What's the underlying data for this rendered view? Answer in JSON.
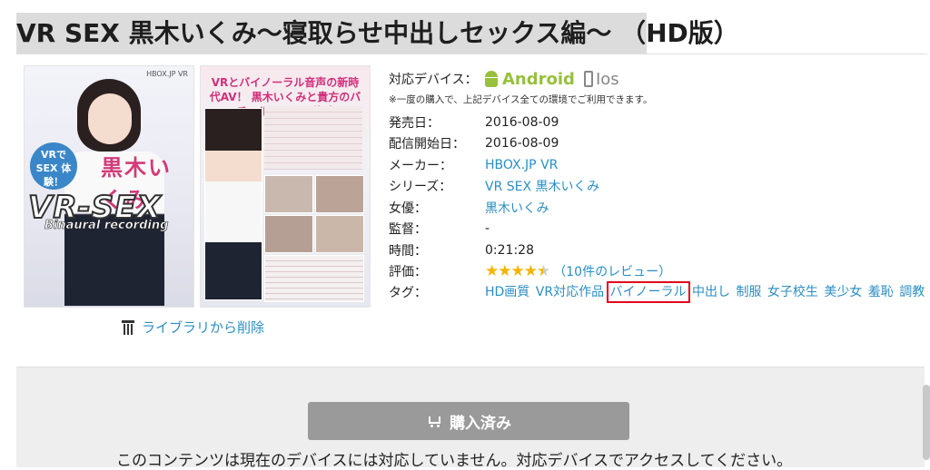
{
  "title": "VR SEX 黒木いくみ〜寝取らせ中出しセックス編〜 （HD版）",
  "cover": {
    "brand": "HBOX.JP VR",
    "badge": "VRで SEX 体験！",
    "name": "黒木いくみ",
    "logo": "VR-SEX",
    "sub": "Binaural recording"
  },
  "back_cover": {
    "headline": "VRとバイノーラル音声の新時代AV！ 黒木いくみと貴方のバーチャルセックス体験！"
  },
  "devices": {
    "label": "対応デバイス：",
    "android": "Android",
    "ios": "Ios",
    "note": "※一度の購入で、上記デバイス全ての環境でご利用できます。"
  },
  "details": {
    "release_label": "発売日：",
    "release": "2016-08-09",
    "stream_label": "配信開始日：",
    "stream": "2016-08-09",
    "maker_label": "メーカー：",
    "maker": "HBOX.JP VR",
    "series_label": "シリーズ：",
    "series": "VR SEX 黒木いくみ",
    "actress_label": "女優：",
    "actress": "黒木いくみ",
    "director_label": "監督：",
    "director": "-",
    "duration_label": "時間：",
    "duration": "0:21:28",
    "rating_label": "評価：",
    "rating": 4.5,
    "rating_max": 5,
    "stars": "★★★★★",
    "reviews": "（10件のレビュー）",
    "tags_label": "タグ："
  },
  "tags": [
    "HD画質",
    "VR対応作品",
    "バイノーラル",
    "中出し",
    "制服",
    "女子校生",
    "美少女",
    "羞恥",
    "調教"
  ],
  "highlighted_tag": "バイノーラル",
  "library": {
    "delete_label": "ライブラリから削除"
  },
  "purchase": {
    "button_label": "購入済み",
    "notice": "このコンテンツは現在のデバイスには対応していません。対応デバイスでアクセスしてください。"
  },
  "colors": {
    "link": "#2b8ec3",
    "star": "#f4b400",
    "android": "#97c03d",
    "highlight": "#e0001a"
  }
}
